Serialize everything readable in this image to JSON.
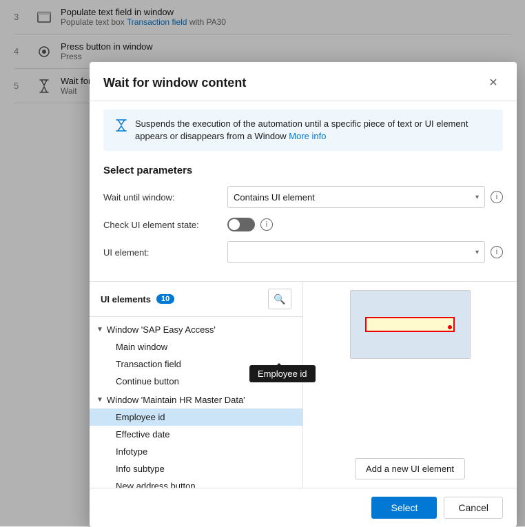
{
  "background": {
    "steps": [
      {
        "num": "3",
        "icon": "window-icon",
        "title": "Populate text field in window",
        "desc_prefix": "Populate text box ",
        "desc_link": "Transaction field",
        "desc_suffix": " with PA30"
      },
      {
        "num": "4",
        "icon": "button-icon",
        "title": "Press button in window",
        "desc_prefix": "Press",
        "desc_link": "",
        "desc_suffix": ""
      },
      {
        "num": "5",
        "icon": "hourglass-icon",
        "title": "Wait for window content",
        "desc_prefix": "Wait",
        "desc_link": "",
        "desc_suffix": ""
      }
    ]
  },
  "modal": {
    "title": "Wait for window content",
    "close_label": "✕",
    "info_text": "Suspends the execution of the automation until a specific piece of text or UI element appears or disappears from a Window",
    "info_link_text": "More info",
    "params_title": "Select parameters",
    "wait_until_label": "Wait until window:",
    "wait_until_value": "Contains UI element",
    "check_state_label": "Check UI element state:",
    "ui_element_label": "UI element:",
    "ui_element_placeholder": "",
    "ui_elements_label": "UI elements",
    "ui_elements_count": "10",
    "search_icon": "🔍",
    "tree": {
      "group1": {
        "label": "Window 'SAP Easy Access'",
        "items": [
          "Main window",
          "Transaction field",
          "Continue button"
        ]
      },
      "group2": {
        "label": "Window 'Maintain HR Master Data'",
        "items": [
          "Employee id",
          "Effective date",
          "Infotype",
          "Info subtype",
          "New address button"
        ]
      }
    },
    "selected_item": "Employee id",
    "tooltip_text": "Employee id",
    "add_ui_button_label": "Add a new UI element",
    "select_button_label": "Select",
    "cancel_button_label": "Cancel"
  }
}
